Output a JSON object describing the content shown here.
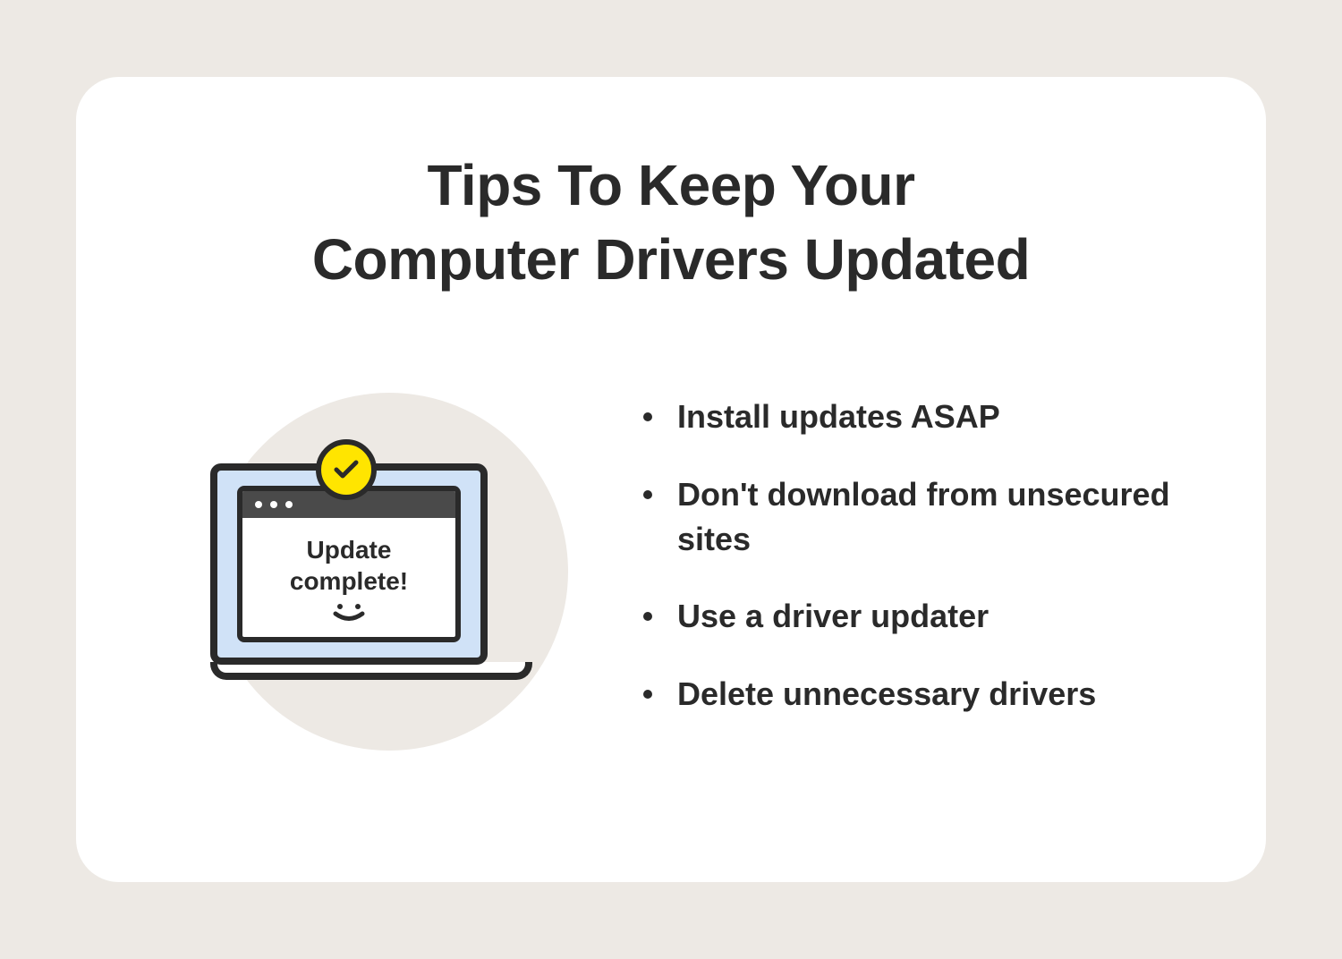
{
  "heading": {
    "line1": "Tips To Keep Your",
    "line2": "Computer Drivers Updated"
  },
  "illustration": {
    "window_text_line1": "Update",
    "window_text_line2": "complete!"
  },
  "tips": [
    "Install updates ASAP",
    "Don't download from unsecured sites",
    "Use a driver updater",
    "Delete unnecessary drivers"
  ],
  "colors": {
    "background": "#ede9e4",
    "card": "#ffffff",
    "text": "#2a2a2a",
    "accent_yellow": "#ffe500",
    "screen_blue": "#d0e2f7"
  }
}
